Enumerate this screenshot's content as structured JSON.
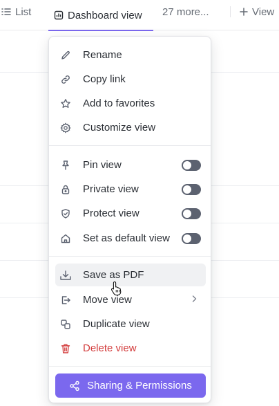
{
  "tabs": {
    "list": "List",
    "dashboard": "Dashboard view",
    "more": "27 more...",
    "add_view": "View"
  },
  "menu": {
    "group1": [
      {
        "label": "Rename",
        "icon": "pencil-icon"
      },
      {
        "label": "Copy link",
        "icon": "link-icon"
      },
      {
        "label": "Add to favorites",
        "icon": "star-icon"
      },
      {
        "label": "Customize view",
        "icon": "gear-icon"
      }
    ],
    "group2": [
      {
        "label": "Pin view",
        "icon": "pin-icon",
        "toggle": false
      },
      {
        "label": "Private view",
        "icon": "lock-icon",
        "toggle": false
      },
      {
        "label": "Protect view",
        "icon": "shield-icon",
        "toggle": false
      },
      {
        "label": "Set as default view",
        "icon": "home-icon",
        "toggle": false
      }
    ],
    "group3": [
      {
        "label": "Save as PDF",
        "icon": "download-icon",
        "hovered": true
      },
      {
        "label": "Move view",
        "icon": "move-icon",
        "submenu": true
      },
      {
        "label": "Duplicate view",
        "icon": "duplicate-icon"
      },
      {
        "label": "Delete view",
        "icon": "trash-icon",
        "danger": true
      }
    ],
    "share_button": "Sharing & Permissions"
  },
  "colors": {
    "accent": "#7b68ee",
    "danger": "#d33d3d",
    "toggle_off": "#5c6270"
  }
}
